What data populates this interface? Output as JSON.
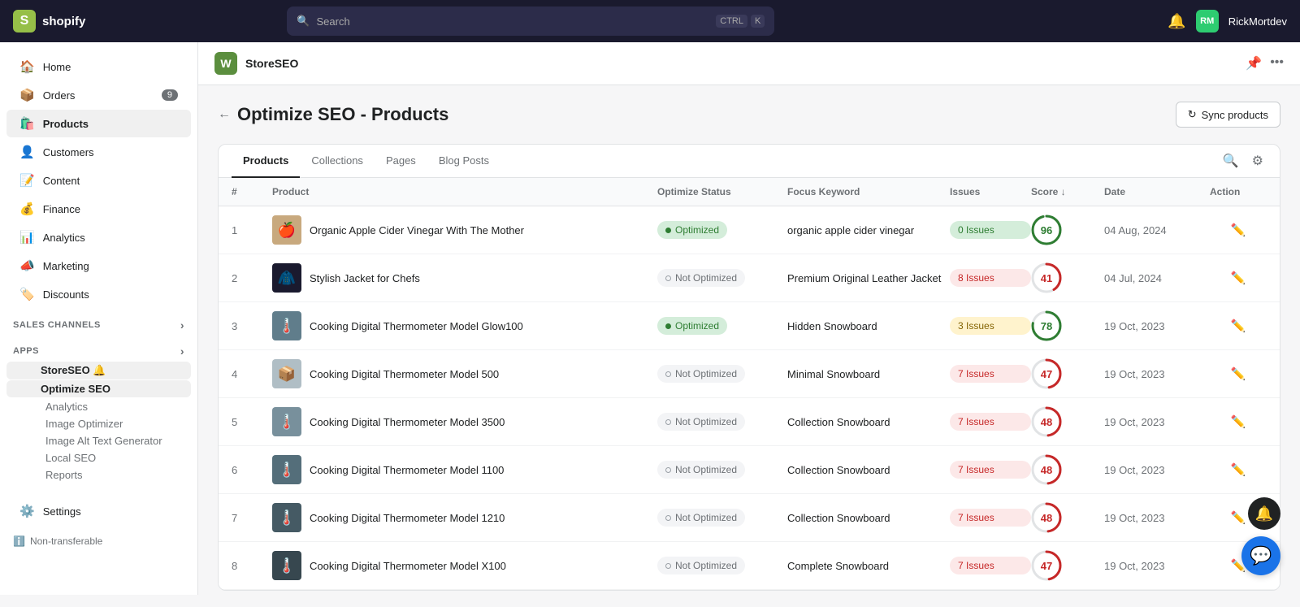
{
  "topnav": {
    "logo_text": "shopify",
    "search_placeholder": "Search",
    "shortcut_ctrl": "CTRL",
    "shortcut_k": "K",
    "username": "RickMortdev"
  },
  "sidebar": {
    "main_items": [
      {
        "id": "home",
        "label": "Home",
        "icon": "🏠",
        "badge": null
      },
      {
        "id": "orders",
        "label": "Orders",
        "icon": "📦",
        "badge": "9"
      },
      {
        "id": "products",
        "label": "Products",
        "icon": "🛍️",
        "badge": null
      },
      {
        "id": "customers",
        "label": "Customers",
        "icon": "👤",
        "badge": null
      },
      {
        "id": "content",
        "label": "Content",
        "icon": "📝",
        "badge": null
      },
      {
        "id": "finance",
        "label": "Finance",
        "icon": "💰",
        "badge": null
      },
      {
        "id": "analytics",
        "label": "Analytics",
        "icon": "📊",
        "badge": null
      },
      {
        "id": "marketing",
        "label": "Marketing",
        "icon": "📣",
        "badge": null
      },
      {
        "id": "discounts",
        "label": "Discounts",
        "icon": "🏷️",
        "badge": null
      }
    ],
    "sales_channels_label": "Sales channels",
    "apps_label": "Apps",
    "app_name": "StoreSEO",
    "app_sub": "Optimize SEO",
    "app_children": [
      "Analytics",
      "Image Optimizer",
      "Image Alt Text Generator",
      "Local SEO",
      "Reports"
    ],
    "settings_label": "Settings",
    "settings_icon": "⚙️",
    "nontransferable_label": "Non-transferable"
  },
  "app_header": {
    "logo_letter": "W",
    "title": "StoreSEO",
    "pin_icon": "📌",
    "more_icon": "..."
  },
  "page": {
    "back_label": "←",
    "title": "Optimize SEO - Products",
    "sync_btn": "Sync products"
  },
  "tabs": [
    {
      "id": "products",
      "label": "Products",
      "active": true
    },
    {
      "id": "collections",
      "label": "Collections",
      "active": false
    },
    {
      "id": "pages",
      "label": "Pages",
      "active": false
    },
    {
      "id": "blog-posts",
      "label": "Blog Posts",
      "active": false
    }
  ],
  "table": {
    "columns": [
      "#",
      "Product",
      "Optimize Status",
      "Focus Keyword",
      "Issues",
      "Score",
      "Date",
      "Action"
    ],
    "rows": [
      {
        "num": "1",
        "name": "Organic Apple Cider Vinegar With The Mother",
        "thumb_color": "#c8a97e",
        "thumb_text": "🍎",
        "status": "Optimized",
        "status_type": "optimized",
        "keyword": "organic apple cider vinegar",
        "issues": "0 Issues",
        "issues_type": "none",
        "score": 96,
        "score_color": "#2e7d32",
        "score_pct": 96,
        "date": "04 Aug, 2024"
      },
      {
        "num": "2",
        "name": "Stylish Jacket for Chefs",
        "thumb_color": "#1a1a2e",
        "thumb_text": "🧥",
        "status": "Not Optimized",
        "status_type": "not-optimized",
        "keyword": "Premium Original Leather Jacket",
        "issues": "8 Issues",
        "issues_type": "some",
        "score": 41,
        "score_color": "#c62828",
        "score_pct": 41,
        "date": "04 Jul, 2024"
      },
      {
        "num": "3",
        "name": "Cooking Digital Thermometer Model Glow100",
        "thumb_color": "#607d8b",
        "thumb_text": "🌡️",
        "status": "Optimized",
        "status_type": "optimized",
        "keyword": "Hidden Snowboard",
        "issues": "3 Issues",
        "issues_type": "warn",
        "score": 78,
        "score_color": "#2e7d32",
        "score_pct": 78,
        "date": "19 Oct, 2023"
      },
      {
        "num": "4",
        "name": "Cooking Digital Thermometer Model 500",
        "thumb_color": "#b0bec5",
        "thumb_text": "📦",
        "status": "Not Optimized",
        "status_type": "not-optimized",
        "keyword": "Minimal Snowboard",
        "issues": "7 Issues",
        "issues_type": "some",
        "score": 47,
        "score_color": "#c62828",
        "score_pct": 47,
        "date": "19 Oct, 2023"
      },
      {
        "num": "5",
        "name": "Cooking Digital Thermometer Model 3500",
        "thumb_color": "#78909c",
        "thumb_text": "🌡️",
        "status": "Not Optimized",
        "status_type": "not-optimized",
        "keyword": "Collection Snowboard",
        "issues": "7 Issues",
        "issues_type": "some",
        "score": 48,
        "score_color": "#c62828",
        "score_pct": 48,
        "date": "19 Oct, 2023"
      },
      {
        "num": "6",
        "name": "Cooking Digital Thermometer Model 1100",
        "thumb_color": "#546e7a",
        "thumb_text": "🌡️",
        "status": "Not Optimized",
        "status_type": "not-optimized",
        "keyword": "Collection Snowboard",
        "issues": "7 Issues",
        "issues_type": "some",
        "score": 48,
        "score_color": "#c62828",
        "score_pct": 48,
        "date": "19 Oct, 2023"
      },
      {
        "num": "7",
        "name": "Cooking Digital Thermometer Model 1210",
        "thumb_color": "#455a64",
        "thumb_text": "🌡️",
        "status": "Not Optimized",
        "status_type": "not-optimized",
        "keyword": "Collection Snowboard",
        "issues": "7 Issues",
        "issues_type": "some",
        "score": 48,
        "score_color": "#c62828",
        "score_pct": 48,
        "date": "19 Oct, 2023"
      },
      {
        "num": "8",
        "name": "Cooking Digital Thermometer Model X100",
        "thumb_color": "#37474f",
        "thumb_text": "🌡️",
        "status": "Not Optimized",
        "status_type": "not-optimized",
        "keyword": "Complete Snowboard",
        "issues": "7 Issues",
        "issues_type": "some",
        "score": 47,
        "score_color": "#c62828",
        "score_pct": 47,
        "date": "19 Oct, 2023"
      }
    ]
  }
}
